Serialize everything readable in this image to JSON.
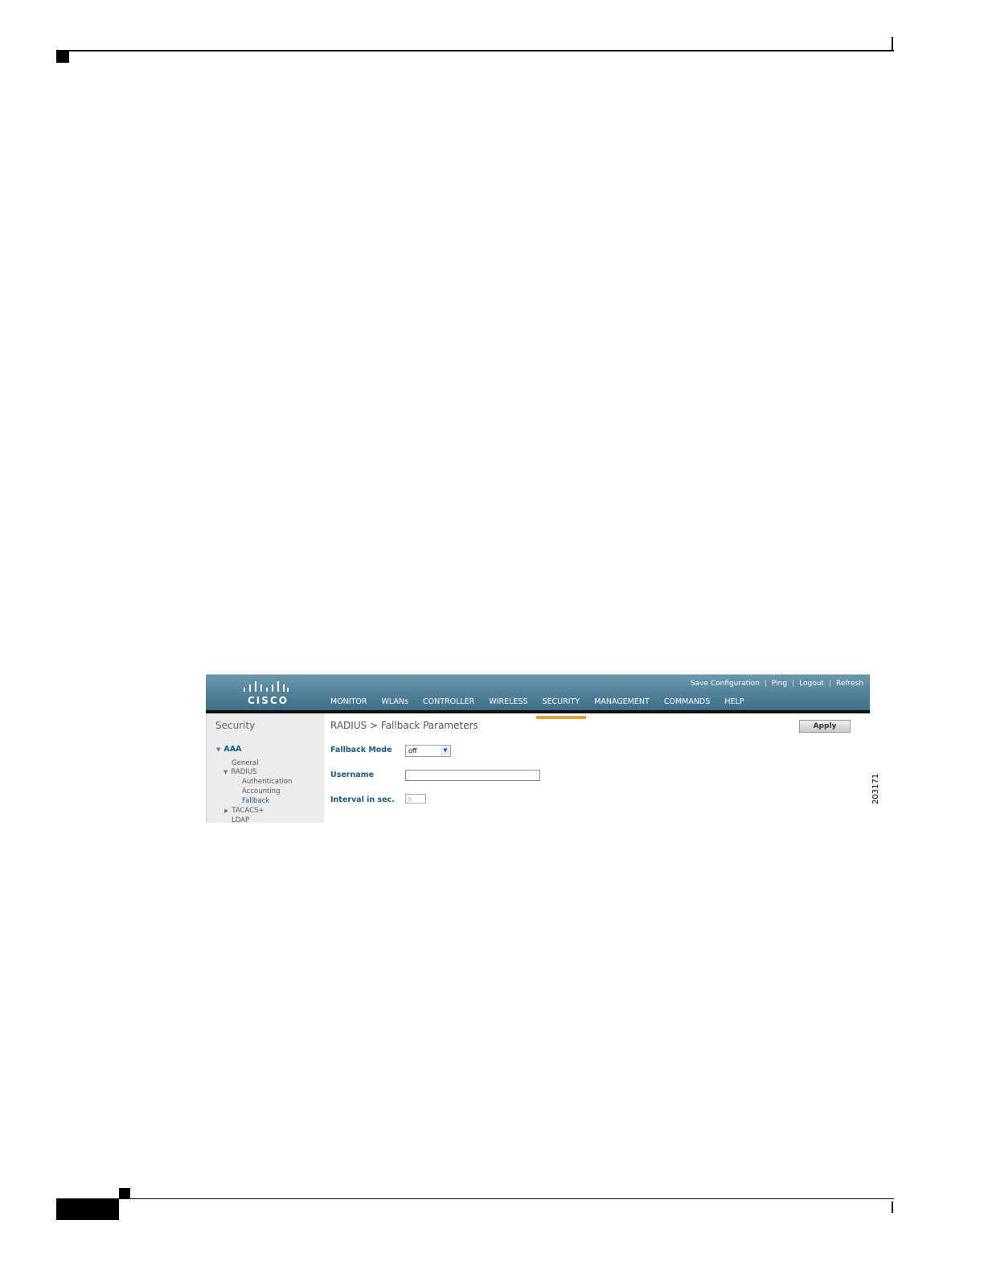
{
  "screenshot": {
    "top_links": [
      "Save Configuration",
      "Ping",
      "Logout",
      "Refresh"
    ],
    "logo_text": "CISCO",
    "nav": [
      "MONITOR",
      "WLANs",
      "CONTROLLER",
      "WIRELESS",
      "SECURITY",
      "MANAGEMENT",
      "COMMANDS",
      "HELP"
    ],
    "active_nav": "SECURITY",
    "sidebar": {
      "title": "Security",
      "aaa": "AAA",
      "items": [
        "General",
        "RADIUS",
        "Authentication",
        "Accounting",
        "Fallback",
        "TACACS+",
        "LDAP"
      ],
      "selected": "Fallback"
    },
    "content": {
      "title": "RADIUS > Fallback Parameters",
      "apply": "Apply",
      "fallback_mode_label": "Fallback Mode",
      "fallback_mode_value": "off",
      "username_label": "Username",
      "username_value": "",
      "interval_label": "Interval in sec.",
      "interval_value": "0"
    }
  },
  "figure_number": "203171",
  "colors": {
    "topbar": "#4f7e97",
    "active_tab_underline": "#e3a23a",
    "label_blue": "#1c5a8a"
  }
}
